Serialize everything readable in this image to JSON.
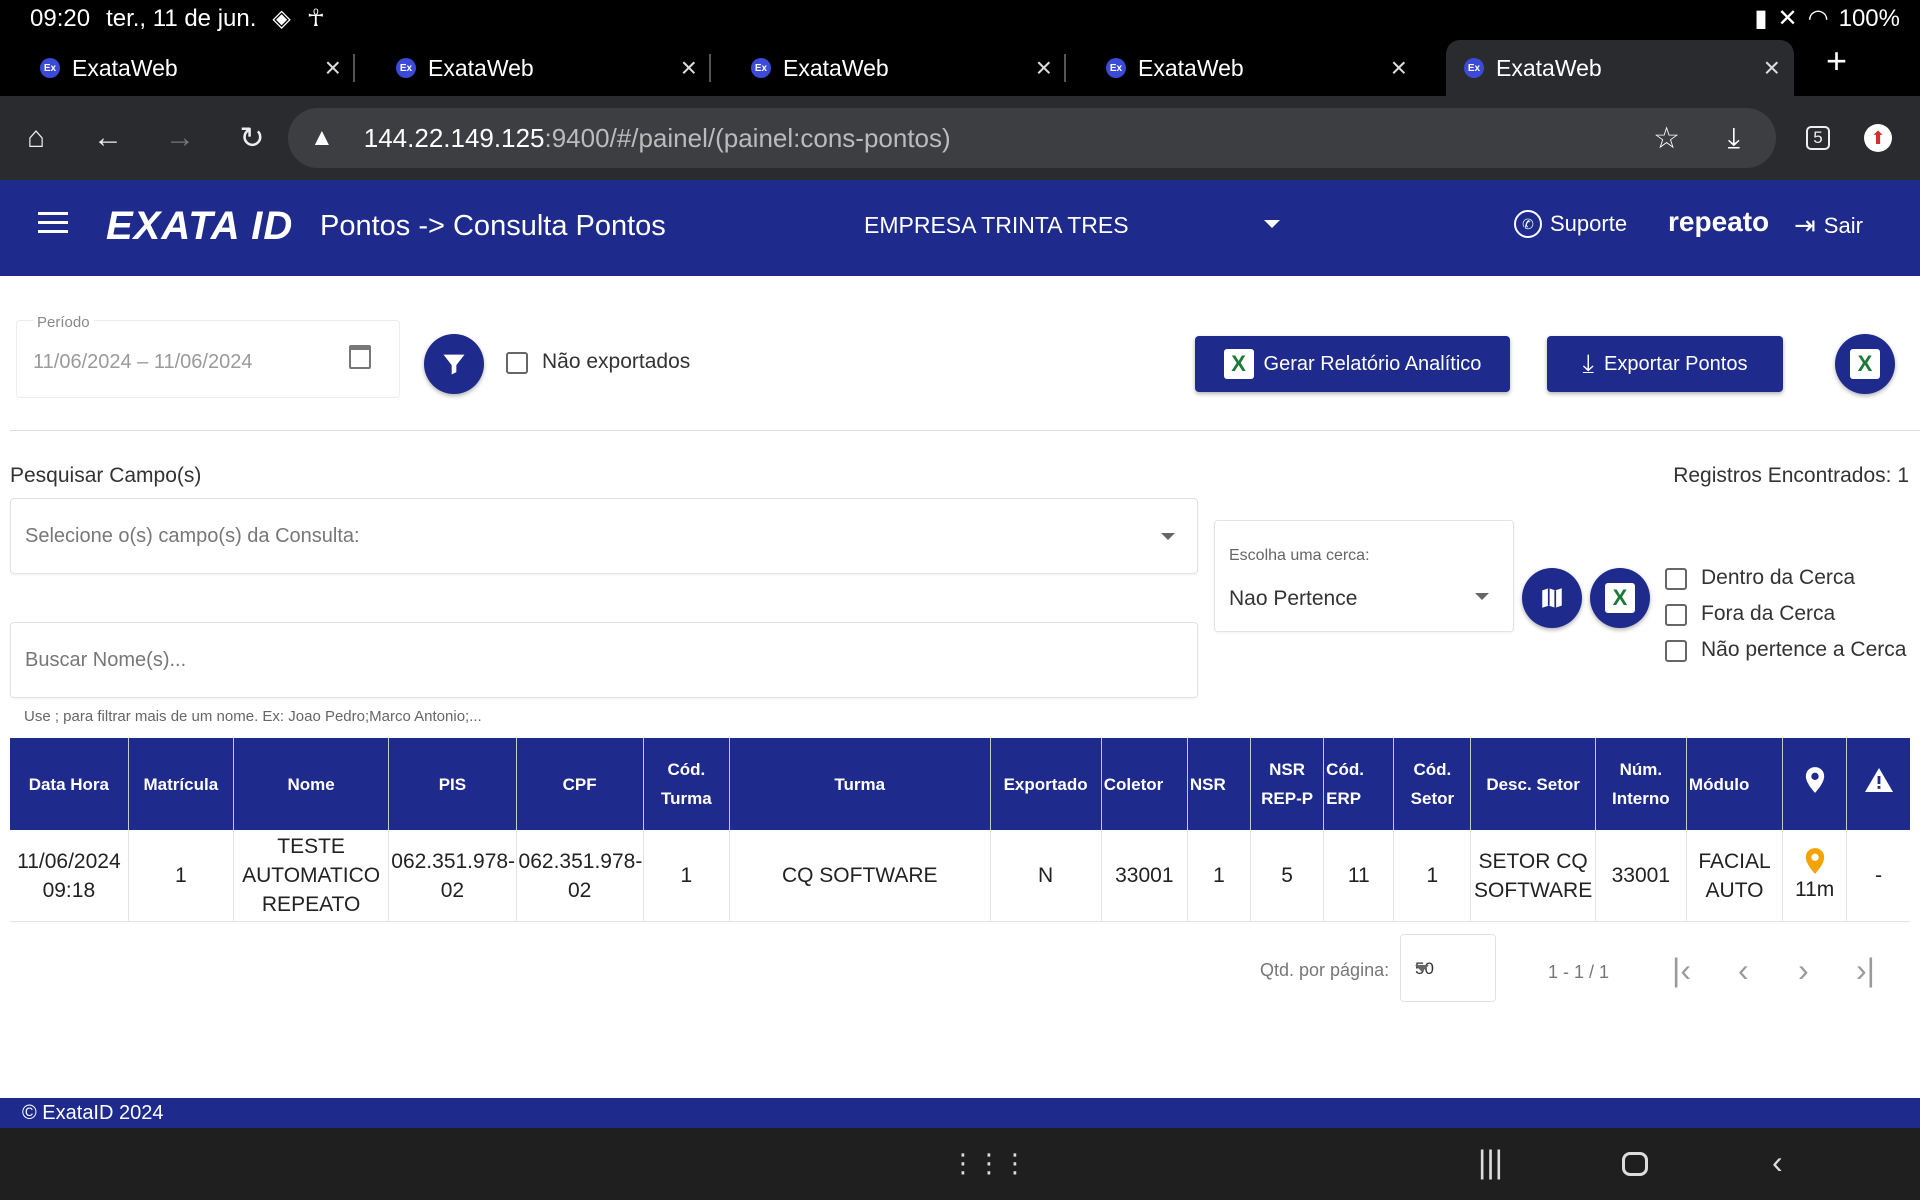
{
  "status_bar": {
    "time": "09:20",
    "date": "ter., 11 de jun.",
    "battery": "100%"
  },
  "tabs": [
    {
      "title": "ExataWeb",
      "favicon": "Ex"
    },
    {
      "title": "ExataWeb",
      "favicon": "Ex"
    },
    {
      "title": "ExataWeb",
      "favicon": "Ex"
    },
    {
      "title": "ExataWeb",
      "favicon": "Ex"
    },
    {
      "title": "ExataWeb",
      "favicon": "Ex"
    }
  ],
  "browser": {
    "url_host": "144.22.149.125",
    "url_rest": ":9400/#/painel/(painel:cons-pontos)",
    "tab_count": "5"
  },
  "header": {
    "logo": "EXATA ID",
    "title": "Pontos -> Consulta Pontos",
    "company": "EMPRESA TRINTA TRES",
    "support_label": "Suporte",
    "username": "repeato",
    "logout_label": "Sair",
    "bg_color": "#1e2a8c"
  },
  "filters": {
    "periodo_label": "Período",
    "periodo_value": "11/06/2024 – 11/06/2024",
    "nao_exportados_label": "Não exportados",
    "gerar_relatorio_label": "Gerar Relatório Analítico",
    "exportar_label": "Exportar Pontos"
  },
  "search": {
    "pesquisar_label": "Pesquisar Campo(s)",
    "registros_label": "Registros Encontrados: 1",
    "campos_placeholder": "Selecione o(s) campo(s) da Consulta:",
    "buscar_placeholder": "Buscar Nome(s)...",
    "hint": "Use ; para filtrar mais de um nome. Ex: Joao Pedro;Marco Antonio;...",
    "cerca_label": "Escolha uma cerca:",
    "cerca_value": "Nao Pertence",
    "cerca_options": [
      "Dentro da Cerca",
      "Fora da Cerca",
      "Não pertence a Cerca"
    ]
  },
  "table": {
    "headers": [
      "Data Hora",
      "Matrícula",
      "Nome",
      "PIS",
      "CPF",
      "Cód. Turma",
      "Turma",
      "Exportado",
      "Coletor",
      "NSR",
      "NSR REP-P",
      "Cód. ERP",
      "Cód. Setor",
      "Desc. Setor",
      "Núm. Interno",
      "Módulo",
      "",
      ""
    ],
    "rows": [
      [
        "11/06/2024 09:18",
        "1",
        "TESTE AUTOMATICO REPEATO",
        "062.351.978-02",
        "062.351.978-02",
        "1",
        "CQ SOFTWARE",
        "N",
        "33001",
        "1",
        "5",
        "11",
        "1",
        "SETOR CQ SOFTWARE",
        "33001",
        "FACIAL AUTO",
        "11m",
        "-"
      ]
    ]
  },
  "paginator": {
    "qtd_label": "Qtd. por página:",
    "qtd_value": "50",
    "range": "1 - 1 / 1"
  },
  "footer": {
    "text": "© ExataID 2024"
  }
}
